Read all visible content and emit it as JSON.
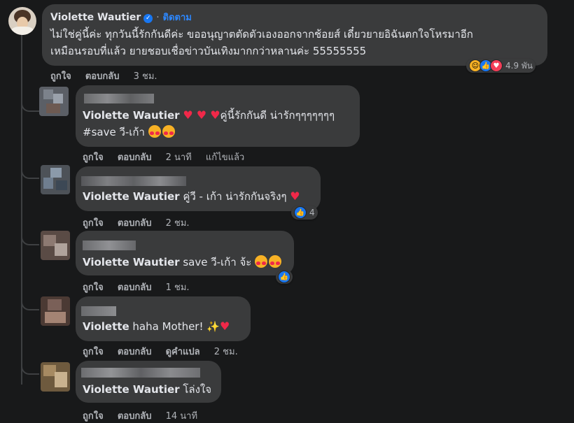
{
  "top": {
    "author": "Violette Wautier",
    "sep": "·",
    "follow": "ติดตาม",
    "line1": "ไม่ใช่คู่นี้ค่ะ ทุกวันนี้รักกันดีค่ะ ขออนุญาตตัดตัวเองออกจากช้อยส์ เดี๋ยวยายอิฉันตกใจโหรมาอีก",
    "line2": "เหมือนรอบที่แล้ว ยายชอบเชื่อข่าวบันเทิงมากกว่าหลานค่ะ 55555555",
    "like": "ถูกใจ",
    "reply": "ตอบกลับ",
    "time": "3 ชม.",
    "reaction_count": "4.9 พัน"
  },
  "replies": [
    {
      "mention": "Violette Wautier",
      "text_a": "คู่นี้รักกันดี น่ารักๆๆๆๆๆๆๆ",
      "text_b": "#save วี-เก้า",
      "like": "ถูกใจ",
      "reply": "ตอบกลับ",
      "time": "2 นาที",
      "edited": "แก้ไขแล้ว"
    },
    {
      "mention": "Violette Wautier",
      "text": "คู่วี - เก้า น่ารักกันจริงๆ",
      "like": "ถูกใจ",
      "reply": "ตอบกลับ",
      "time": "2 ชม.",
      "reaction_count": "4"
    },
    {
      "mention": "Violette Wautier",
      "text": "save วี-เก้า จ้ะ",
      "like": "ถูกใจ",
      "reply": "ตอบกลับ",
      "time": "1 ชม."
    },
    {
      "mention": "Violette",
      "text": "haha Mother!",
      "like": "ถูกใจ",
      "reply": "ตอบกลับ",
      "translate": "ดูคำแปล",
      "time": "2 ชม."
    },
    {
      "mention": "Violette Wautier",
      "text": "โล่งใจ",
      "like": "ถูกใจ",
      "reply": "ตอบกลับ",
      "time": "14 นาที"
    }
  ],
  "colors": {
    "bg": "#18191a",
    "bubble": "#3a3b3c",
    "text": "#e4e6eb",
    "meta": "#b0b3b8",
    "link": "#2d88ff",
    "like": "#1877f2",
    "love": "#f33e58"
  },
  "icons": [
    "verified-badge-icon",
    "like-reaction-icon",
    "love-reaction-icon",
    "haha-reaction-icon",
    "heart-emoji",
    "heart-eyes-emoji",
    "sparkles-emoji"
  ]
}
